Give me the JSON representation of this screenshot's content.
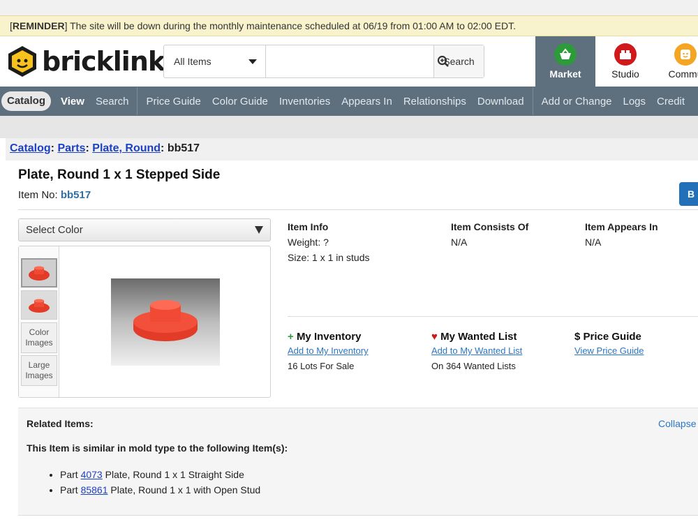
{
  "reminder": {
    "tag": "REMINDER",
    "text": " The site will be down during the monthly maintenance scheduled at 06/19 from 01:00 AM to 02:00 EDT."
  },
  "header": {
    "logo_text": "bricklink",
    "search": {
      "category": "All Items",
      "placeholder": "",
      "button": "Search"
    },
    "tiles": [
      {
        "label": "Market",
        "color": "#2e9b3a"
      },
      {
        "label": "Studio",
        "color": "#d0191b"
      },
      {
        "label": "Commu",
        "color": "#f4a623"
      }
    ]
  },
  "nav": {
    "catalog": "Catalog",
    "items": [
      "View",
      "Search",
      "Price Guide",
      "Color Guide",
      "Inventories",
      "Appears In",
      "Relationships",
      "Download",
      "Add or Change",
      "Logs",
      "Credit"
    ]
  },
  "breadcrumb": {
    "catalog": "Catalog",
    "parts": "Parts",
    "category": "Plate, Round",
    "item": "bb517"
  },
  "item": {
    "title": "Plate, Round 1 x 1 Stepped Side",
    "item_no_label": "Item No: ",
    "item_no": "bb517",
    "buy_label": "B"
  },
  "select_color": "Select Color",
  "gallery": {
    "color_images": "Color Images",
    "large_images": "Large Images"
  },
  "info": {
    "item_info": {
      "heading": "Item Info",
      "weight": "Weight: ?",
      "size": "Size: 1 x 1 in studs"
    },
    "consists_of": {
      "heading": "Item Consists Of",
      "value": "N/A"
    },
    "appears_in": {
      "heading": "Item Appears In",
      "value": "N/A"
    }
  },
  "actions": {
    "inventory": {
      "symbol": "+",
      "heading": "My Inventory",
      "link": "Add to My Inventory",
      "stat": "16 Lots For Sale"
    },
    "wanted": {
      "symbol": "♥",
      "heading": "My Wanted List",
      "link": "Add to My Wanted List",
      "stat": "On 364 Wanted Lists"
    },
    "price": {
      "symbol": "$",
      "heading": "Price Guide",
      "link": "View Price Guide"
    }
  },
  "related": {
    "label": "Related Items:",
    "collapse": "Collapse",
    "similar": "This Item is similar in mold type to the following Item(s):",
    "items": [
      {
        "prefix": "Part ",
        "id": "4073",
        "name": " Plate, Round 1 x 1 Straight Side"
      },
      {
        "prefix": "Part ",
        "id": "85861",
        "name": " Plate, Round 1 x 1 with Open Stud"
      }
    ]
  }
}
